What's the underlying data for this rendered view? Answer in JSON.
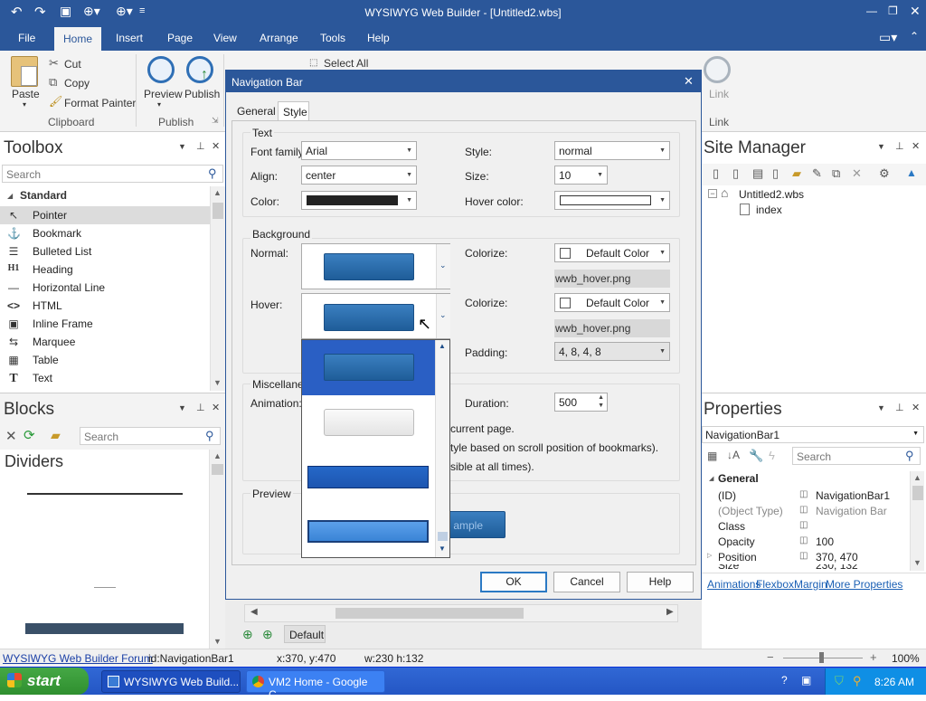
{
  "window": {
    "title": "WYSIWYG Web Builder - [Untitled2.wbs]"
  },
  "ribbon": {
    "tabs": [
      "File",
      "Home",
      "Insert",
      "Page",
      "View",
      "Arrange",
      "Tools",
      "Help"
    ],
    "paste": "Paste",
    "cut": "Cut",
    "copy": "Copy",
    "format_painter": "Format Painter",
    "clipboard": "Clipboard",
    "preview": "Preview",
    "publish": "Publish",
    "publish_group": "Publish",
    "select_all": "Select All",
    "link": "Link",
    "link_group": "Link"
  },
  "toolbox": {
    "title": "Toolbox",
    "search_placeholder": "Search",
    "category": "Standard",
    "items": [
      {
        "label": "Pointer",
        "icon": "pointer-icon"
      },
      {
        "label": "Bookmark",
        "icon": "anchor-icon"
      },
      {
        "label": "Bulleted List",
        "icon": "list-icon"
      },
      {
        "label": "Heading",
        "icon": "heading-icon"
      },
      {
        "label": "Horizontal Line",
        "icon": "line-icon"
      },
      {
        "label": "HTML",
        "icon": "code-icon"
      },
      {
        "label": "Inline Frame",
        "icon": "frame-icon"
      },
      {
        "label": "Marquee",
        "icon": "marquee-icon"
      },
      {
        "label": "Table",
        "icon": "table-icon"
      },
      {
        "label": "Text",
        "icon": "text-icon"
      }
    ]
  },
  "blocks": {
    "title": "Blocks",
    "search_placeholder": "Search",
    "section": "Dividers"
  },
  "site_manager": {
    "title": "Site Manager",
    "root": "Untitled2.wbs",
    "page": "index"
  },
  "properties": {
    "title": "Properties",
    "object": "NavigationBar1",
    "search_placeholder": "Search",
    "group": "General",
    "rows": [
      {
        "name": "(ID)",
        "value": "NavigationBar1",
        "dim": false
      },
      {
        "name": "(Object Type)",
        "value": "Navigation Bar",
        "dim": true
      },
      {
        "name": "Class",
        "value": "",
        "dim": false
      },
      {
        "name": "Opacity",
        "value": "100",
        "dim": false
      },
      {
        "name": "Position",
        "value": "370, 470",
        "dim": false
      },
      {
        "name": "Size",
        "value": "230, 132",
        "dim": false
      }
    ],
    "links": [
      "Animations",
      "Flexbox",
      "Margin",
      "More Properties"
    ]
  },
  "dialog": {
    "title": "Navigation Bar",
    "tabs": {
      "general": "General",
      "style": "Style"
    },
    "text_group": "Text",
    "font_family_label": "Font family:",
    "font_family": "Arial",
    "align_label": "Align:",
    "align": "center",
    "color_label": "Color:",
    "color": "#222222",
    "style_label": "Style:",
    "style": "normal",
    "size_label": "Size:",
    "size": "10",
    "hover_color_label": "Hover color:",
    "hover_color": "#ffffff",
    "background_group": "Background",
    "normal_label": "Normal:",
    "hover_label": "Hover:",
    "colorize_label": "Colorize:",
    "colorize_normal": "Default Color",
    "colorize_hover": "Default Color",
    "normal_image": "wwb_hover.png",
    "hover_image": "wwb_hover.png",
    "padding_label": "Padding:",
    "padding": "4, 8, 4, 8",
    "misc_group": "Miscellaneo",
    "animation_label": "Animation:",
    "duration_label": "Duration:",
    "duration": "500",
    "misc_line1": "current page.",
    "misc_line2": "tyle based on scroll position of bookmarks).",
    "misc_line3": "sible at all times).",
    "preview_group": "Preview",
    "preview_text": "ample",
    "ok": "OK",
    "cancel": "Cancel",
    "help": "Help"
  },
  "canvas": {
    "page_tab": "Default"
  },
  "status": {
    "forum_link": "WYSIWYG Web Builder Forum",
    "id": "id:NavigationBar1",
    "xy": "x:370, y:470",
    "wh": "w:230 h:132",
    "zoom": "100%"
  },
  "taskbar": {
    "start": "start",
    "task1": "WYSIWYG Web Build...",
    "task2": "VM2 Home - Google C...",
    "time": "8:26 AM"
  },
  "colors": {
    "accent": "#2b579a",
    "button_blue": "#2a6cb0",
    "selected": "#2a5fc4"
  }
}
